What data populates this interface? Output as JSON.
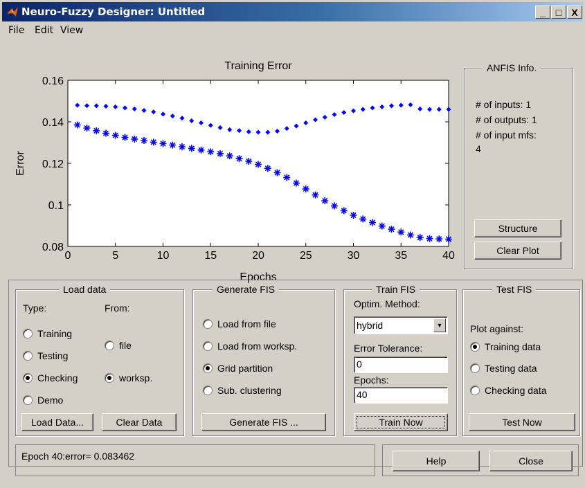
{
  "window": {
    "title": "Neuro-Fuzzy Designer: Untitled",
    "minimize": "_",
    "maximize": "□",
    "close": "X"
  },
  "menu": [
    "File",
    "Edit",
    "View"
  ],
  "chart_data": {
    "type": "scatter",
    "title": "Training Error",
    "xlabel": "Epochs",
    "ylabel": "Error",
    "xlim": [
      0,
      40
    ],
    "ylim": [
      0.08,
      0.16
    ],
    "xticks": [
      "0",
      "5",
      "10",
      "15",
      "20",
      "25",
      "30",
      "35",
      "40"
    ],
    "yticks": [
      "0.08",
      "0.1",
      "0.12",
      "0.14",
      "0.16"
    ],
    "color": "#0000ff",
    "series": [
      {
        "marker": "dot",
        "x": [
          1,
          2,
          3,
          4,
          5,
          6,
          7,
          8,
          9,
          10,
          11,
          12,
          13,
          14,
          15,
          16,
          17,
          18,
          19,
          20,
          21,
          22,
          23,
          24,
          25,
          26,
          27,
          28,
          29,
          30,
          31,
          32,
          33,
          34,
          35,
          36,
          37,
          38,
          39,
          40
        ],
        "values": [
          0.148,
          0.1478,
          0.1477,
          0.1475,
          0.1472,
          0.1467,
          0.1462,
          0.1455,
          0.1448,
          0.1437,
          0.1428,
          0.1418,
          0.1405,
          0.1395,
          0.1383,
          0.1372,
          0.1362,
          0.1358,
          0.1352,
          0.135,
          0.135,
          0.1355,
          0.1368,
          0.138,
          0.1395,
          0.141,
          0.1422,
          0.1435,
          0.1445,
          0.1453,
          0.146,
          0.1467,
          0.1472,
          0.1477,
          0.148,
          0.1482,
          0.1462,
          0.146,
          0.146,
          0.146
        ]
      },
      {
        "marker": "star",
        "x": [
          1,
          2,
          3,
          4,
          5,
          6,
          7,
          8,
          9,
          10,
          11,
          12,
          13,
          14,
          15,
          16,
          17,
          18,
          19,
          20,
          21,
          22,
          23,
          24,
          25,
          26,
          27,
          28,
          29,
          30,
          31,
          32,
          33,
          34,
          35,
          36,
          37,
          38,
          39,
          40
        ],
        "values": [
          0.1385,
          0.137,
          0.1357,
          0.1345,
          0.1335,
          0.1325,
          0.1317,
          0.131,
          0.1302,
          0.1295,
          0.1288,
          0.128,
          0.1272,
          0.1264,
          0.1256,
          0.1247,
          0.1236,
          0.1223,
          0.121,
          0.1195,
          0.1176,
          0.1155,
          0.1132,
          0.1105,
          0.1077,
          0.1048,
          0.102,
          0.0995,
          0.0972,
          0.095,
          0.0932,
          0.0915,
          0.0898,
          0.0883,
          0.0869,
          0.0855,
          0.0843,
          0.0838,
          0.0836,
          0.0835
        ]
      }
    ]
  },
  "anfis_info": {
    "title": "ANFIS Info.",
    "inputs": "# of inputs: 1",
    "outputs": "# of outputs: 1",
    "input_mfs": "# of input mfs:",
    "mfs_value": "4",
    "structure_button": "Structure",
    "clear_plot_button": "Clear Plot"
  },
  "load_data": {
    "title": "Load data",
    "type_label": "Type:",
    "from_label": "From:",
    "types": [
      {
        "label": "Training",
        "selected": false
      },
      {
        "label": "Testing",
        "selected": false
      },
      {
        "label": "Checking",
        "selected": true
      },
      {
        "label": "Demo",
        "selected": false
      }
    ],
    "sources": [
      {
        "label": "file",
        "selected": false
      },
      {
        "label": "worksp.",
        "selected": true
      }
    ],
    "load_button": "Load Data...",
    "clear_button": "Clear Data"
  },
  "generate_fis": {
    "title": "Generate FIS",
    "options": [
      {
        "label": "Load from file",
        "selected": false
      },
      {
        "label": "Load from worksp.",
        "selected": false
      },
      {
        "label": "Grid partition",
        "selected": true
      },
      {
        "label": "Sub. clustering",
        "selected": false
      }
    ],
    "button": "Generate FIS ..."
  },
  "train_fis": {
    "title": "Train FIS",
    "method_label": "Optim. Method:",
    "method_value": "hybrid",
    "tolerance_label": "Error Tolerance:",
    "tolerance_value": "0",
    "epochs_label": "Epochs:",
    "epochs_value": "40",
    "button": "Train Now"
  },
  "test_fis": {
    "title": "Test FIS",
    "plot_label": "Plot against:",
    "options": [
      {
        "label": "Training data",
        "selected": true
      },
      {
        "label": "Testing data",
        "selected": false
      },
      {
        "label": "Checking data",
        "selected": false
      }
    ],
    "button": "Test Now"
  },
  "status": {
    "text": "Epoch 40:error= 0.083462"
  },
  "footer": {
    "help_button": "Help",
    "close_button": "Close"
  }
}
